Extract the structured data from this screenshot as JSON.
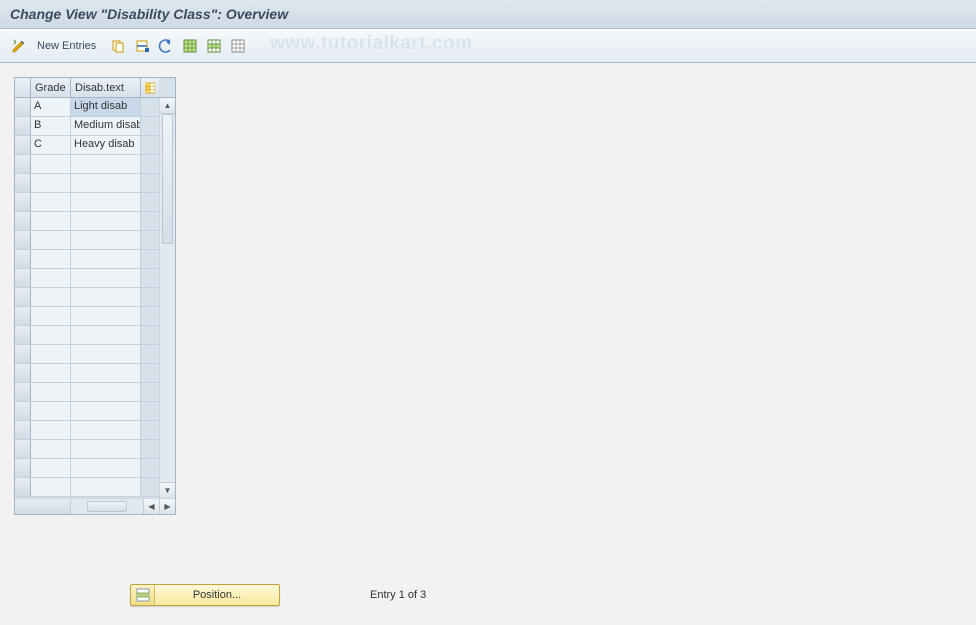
{
  "title": "Change View \"Disability Class\": Overview",
  "watermark": "www.tutorialkart.com",
  "toolbar": {
    "new_entries_label": "New Entries"
  },
  "grid": {
    "columns": {
      "grade": "Grade",
      "text": "Disab.text"
    },
    "rows": [
      {
        "grade": "A",
        "text": "Light disab",
        "selected": true
      },
      {
        "grade": "B",
        "text": "Medium disab",
        "selected": false
      },
      {
        "grade": "C",
        "text": "Heavy disab",
        "selected": false
      }
    ],
    "blank_row_count": 18
  },
  "footer": {
    "position_label": "Position...",
    "entry_status": "Entry 1 of 3"
  },
  "icons": {
    "toggle": "toggle-pencil-icon",
    "copy": "copy-icon",
    "copy_all": "copy-all-icon",
    "undo": "undo-icon",
    "select_all": "select-all-icon",
    "select_block": "select-block-icon",
    "deselect_all": "deselect-all-icon",
    "config": "table-settings-icon",
    "position": "position-icon"
  },
  "colors": {
    "accent": "#3a4b5f",
    "header_bg": "#d7e1ea",
    "cell_bg": "#eef3f7",
    "selected_bg": "#c8d8ea",
    "button_yellow": "#f7e89c"
  }
}
